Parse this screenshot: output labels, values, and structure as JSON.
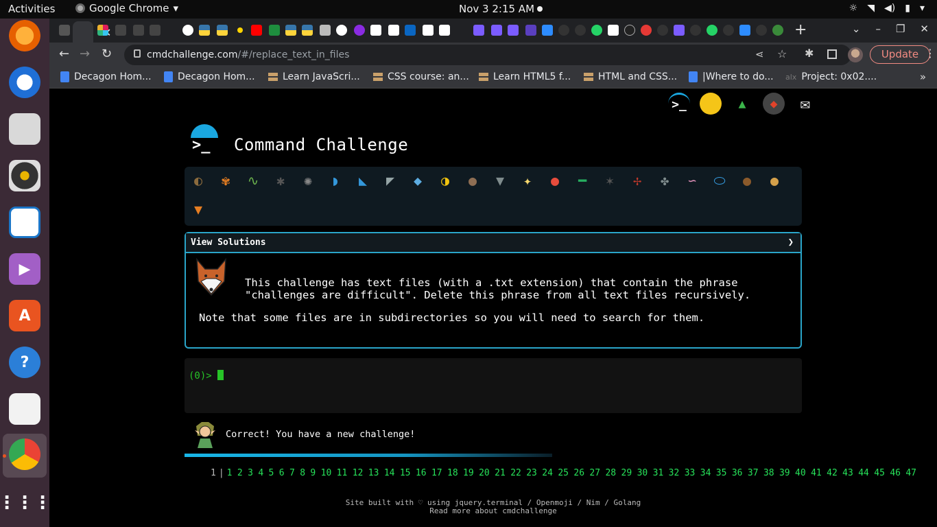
{
  "os": {
    "activities": "Activities",
    "app_name": "Google Chrome",
    "clock": "Nov 3  2:15 AM"
  },
  "browser": {
    "url_host": "cmdchallenge.com",
    "url_path": "/#/replace_text_in_files",
    "update_label": "Update",
    "bookmarks": [
      {
        "label": "Decagon Hom...",
        "icon": "doc"
      },
      {
        "label": "Decagon Hom...",
        "icon": "doc"
      },
      {
        "label": "Learn JavaScri...",
        "icon": "learn"
      },
      {
        "label": "CSS course: an...",
        "icon": "learn"
      },
      {
        "label": "Learn HTML5 f...",
        "icon": "learn"
      },
      {
        "label": "HTML and CSS...",
        "icon": "learn"
      },
      {
        "label": "|Where to do...",
        "icon": "doc"
      },
      {
        "label": "Project: 0x02....",
        "icon": "alx"
      }
    ]
  },
  "page": {
    "title": "Command Challenge",
    "solutions_header": "View Solutions",
    "description": "This challenge has text files (with a .txt extension) that contain the phrase\n\"challenges are difficult\". Delete this phrase from all text files recursively.",
    "note": "Note that some files are in subdirectories so you will need to search for them.",
    "prompt": "(0)>",
    "correct_message": "Correct! You have a new challenge!",
    "current_level": "1",
    "levels": [
      "1",
      "2",
      "3",
      "4",
      "5",
      "6",
      "7",
      "8",
      "9",
      "10",
      "11",
      "12",
      "13",
      "14",
      "15",
      "16",
      "17",
      "18",
      "19",
      "20",
      "21",
      "22",
      "23",
      "24",
      "25",
      "26",
      "27",
      "28",
      "29",
      "30",
      "31",
      "32",
      "33",
      "34",
      "35",
      "36",
      "37",
      "38",
      "39",
      "40",
      "41",
      "42",
      "43",
      "44",
      "45",
      "46",
      "47"
    ],
    "footer_line1": "Site built with ♡ using jquery.terminal / Openmoji / Nim / Golang",
    "footer_line2": "Read more about cmdchallenge"
  },
  "colors": {
    "accent": "#2aa5c9",
    "prompt_green": "#27c427",
    "level_green": "#27e35a",
    "update_red": "#f28b82"
  }
}
